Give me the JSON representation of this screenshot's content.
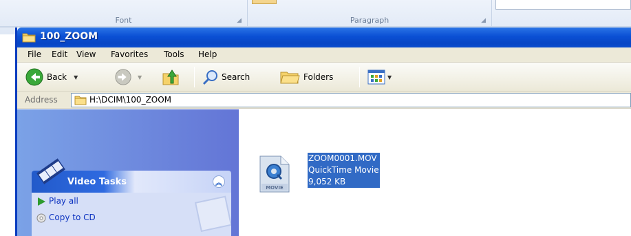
{
  "ribbon": {
    "groups": [
      "Font",
      "Paragraph"
    ]
  },
  "window": {
    "title": "100_ZOOM",
    "menu": [
      "File",
      "Edit",
      "View",
      "Favorites",
      "Tools",
      "Help"
    ],
    "toolbar": {
      "back_label": "Back",
      "search_label": "Search",
      "folders_label": "Folders"
    },
    "address": {
      "label": "Address",
      "value": "H:\\DCIM\\100_ZOOM"
    }
  },
  "taskpane": {
    "title": "Video Tasks",
    "links": [
      "Play all",
      "Copy to CD"
    ]
  },
  "file": {
    "name": "ZOOM0001.MOV",
    "type": "QuickTime Movie",
    "size": "9,052 KB",
    "icon_badge": "MOVIE"
  },
  "colors": {
    "titlebar": "#0a4fd4",
    "selection": "#316ac5",
    "taskpane": "#7ba2e7"
  }
}
